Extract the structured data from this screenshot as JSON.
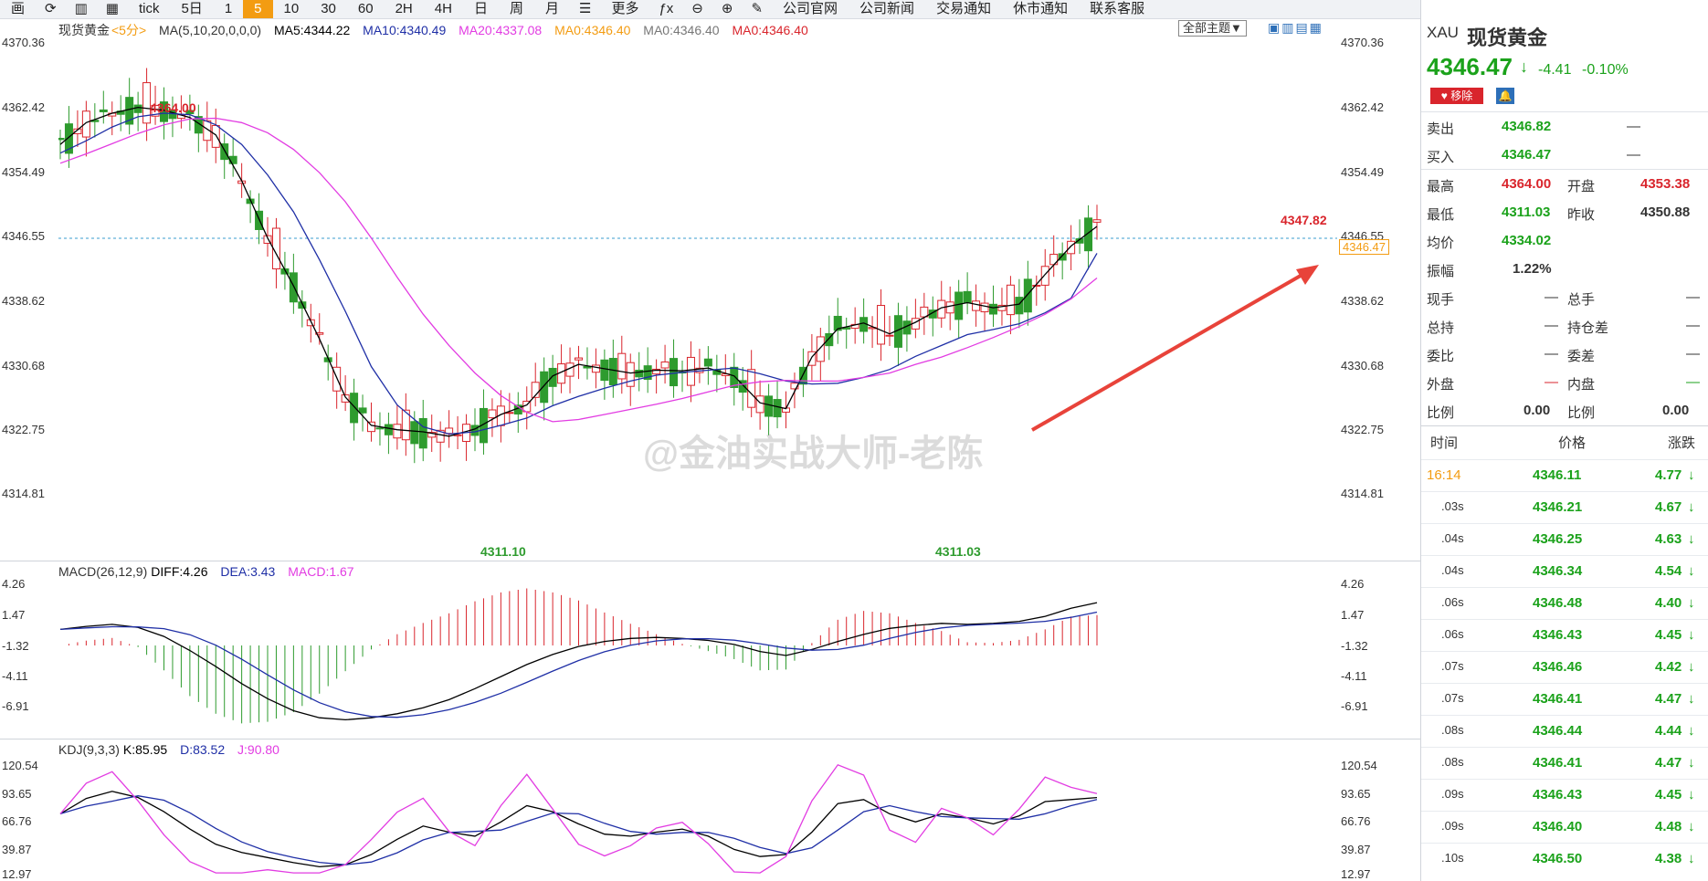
{
  "toolbar": {
    "left_text": "画",
    "periods": [
      "tick",
      "5日",
      "1",
      "5",
      "10",
      "30",
      "60",
      "2H",
      "4H",
      "日",
      "周",
      "月"
    ],
    "active_period": "5",
    "more": "更多",
    "links": [
      "公司官网",
      "公司新闻",
      "交易通知",
      "休市通知",
      "联系客服"
    ]
  },
  "main_legend": {
    "symbol": "现货黄金",
    "period": "<5分>",
    "ma_setting": "MA(5,10,20,0,0,0)",
    "ma5": "MA5:4344.22",
    "ma10": "MA10:4340.49",
    "ma20": "MA20:4337.08",
    "ma0a": "MA0:4346.40",
    "ma0b": "MA0:4346.40",
    "ma0c": "MA0:4346.40",
    "theme_button": "全部主题▼"
  },
  "price_axis": [
    "4370.36",
    "4362.42",
    "4354.49",
    "4346.55",
    "4338.62",
    "4330.68",
    "4322.75",
    "4314.81"
  ],
  "current_price_tag": "4346.47",
  "annotations": {
    "high": "4364.00",
    "low1": "4311.10",
    "low2": "4311.03",
    "recent_high": "4347.82"
  },
  "watermark": "@金油实战大师-老陈",
  "macd_legend": {
    "setting": "MACD(26,12,9)",
    "diff": "DIFF:4.26",
    "dea": "DEA:3.43",
    "macd": "MACD:1.67"
  },
  "macd_axis": [
    "4.26",
    "1.47",
    "-1.32",
    "-4.11",
    "-6.91"
  ],
  "kdj_legend": {
    "setting": "KDJ(9,3,3)",
    "k": "K:85.95",
    "d": "D:83.52",
    "j": "J:90.80"
  },
  "kdj_axis": [
    "120.54",
    "93.65",
    "66.76",
    "39.87",
    "12.97"
  ],
  "colors": {
    "up": "#d9252c",
    "down": "#2e9b2e",
    "ma5": "#000000",
    "ma10": "#1f2fa6",
    "ma20": "#e23ce2",
    "accent": "#f39c12",
    "arrow": "#e8433a"
  },
  "quote": {
    "code": "XAU",
    "name": "现货黄金",
    "price": "4346.47",
    "change": "-4.41",
    "change_pct": "-0.10%",
    "remove_btn": "移除",
    "sell_label": "卖出",
    "sell": "4346.82",
    "sell_vol": "—",
    "buy_label": "买入",
    "buy": "4346.47",
    "buy_vol": "—",
    "high_label": "最高",
    "high": "4364.00",
    "open_label": "开盘",
    "open": "4353.38",
    "low_label": "最低",
    "low": "4311.03",
    "prev_label": "昨收",
    "prev": "4350.88",
    "avg_label": "均价",
    "avg": "4334.02",
    "amp_label": "振幅",
    "amp": "1.22%",
    "hand_label": "现手",
    "hand": "—",
    "total_label": "总手",
    "total": "—",
    "hold_label": "总持",
    "hold": "—",
    "holddiff_label": "持仓差",
    "holddiff": "—",
    "wb_label": "委比",
    "wb": "—",
    "wc_label": "委差",
    "wc": "—",
    "out_label": "外盘",
    "out": "—",
    "in_label": "内盘",
    "in": "—",
    "r1_label": "比例",
    "r1": "0.00",
    "r2_label": "比例",
    "r2": "0.00"
  },
  "ticks_header": {
    "time": "时间",
    "price": "价格",
    "chg": "涨跌"
  },
  "ticks": [
    {
      "t": "16:14",
      "p": "4346.11",
      "c": "4.77"
    },
    {
      "t": ".03s",
      "p": "4346.21",
      "c": "4.67"
    },
    {
      "t": ".04s",
      "p": "4346.25",
      "c": "4.63"
    },
    {
      "t": ".04s",
      "p": "4346.34",
      "c": "4.54"
    },
    {
      "t": ".06s",
      "p": "4346.48",
      "c": "4.40"
    },
    {
      "t": ".06s",
      "p": "4346.43",
      "c": "4.45"
    },
    {
      "t": ".07s",
      "p": "4346.46",
      "c": "4.42"
    },
    {
      "t": ".07s",
      "p": "4346.41",
      "c": "4.47"
    },
    {
      "t": ".08s",
      "p": "4346.44",
      "c": "4.44"
    },
    {
      "t": ".08s",
      "p": "4346.41",
      "c": "4.47"
    },
    {
      "t": ".09s",
      "p": "4346.43",
      "c": "4.45"
    },
    {
      "t": ".09s",
      "p": "4346.40",
      "c": "4.48"
    },
    {
      "t": ".10s",
      "p": "4346.50",
      "c": "4.38"
    }
  ],
  "chart_data": {
    "type": "line",
    "title": "现货黄金 <5分>",
    "ylim": [
      4311.0,
      4370.36
    ],
    "x": [
      0,
      1,
      2,
      3,
      4,
      5,
      6,
      7,
      8,
      9,
      10,
      11,
      12,
      13,
      14,
      15,
      16,
      17,
      18,
      19,
      20,
      21,
      22,
      23,
      24,
      25,
      26,
      27,
      28,
      29,
      30,
      31,
      32,
      33,
      34,
      35,
      36,
      37,
      38,
      39,
      40
    ],
    "series": [
      {
        "name": "MA5",
        "values": [
          4355.5,
          4358.5,
          4359.8,
          4360.6,
          4360.2,
          4359.2,
          4356.8,
          4350.5,
          4342.6,
          4336.0,
          4328.7,
          4320.7,
          4316.8,
          4316.2,
          4315.9,
          4315.3,
          4316.3,
          4318.3,
          4319.6,
          4323.6,
          4325.2,
          4324.6,
          4324.0,
          4324.4,
          4324.3,
          4324.7,
          4323.6,
          4319.9,
          4319.1,
          4326.2,
          4330.1,
          4330.9,
          4329.4,
          4331.0,
          4333.0,
          4333.7,
          4333.0,
          4333.5,
          4337.6,
          4341.5,
          4344.2
        ]
      },
      {
        "name": "MA10",
        "values": [
          4354.3,
          4356.0,
          4357.9,
          4359.3,
          4359.8,
          4359.6,
          4358.2,
          4355.5,
          4351.3,
          4346.2,
          4339.6,
          4332.5,
          4324.9,
          4319.6,
          4316.6,
          4315.6,
          4315.9,
          4316.8,
          4317.8,
          4319.5,
          4320.8,
          4321.9,
          4322.9,
          4323.7,
          4324.1,
          4324.4,
          4324.7,
          4323.9,
          4322.9,
          4322.5,
          4322.6,
          4323.4,
          4324.5,
          4326.3,
          4327.8,
          4329.3,
          4330.0,
          4330.8,
          4332.3,
          4334.3,
          4340.5
        ]
      },
      {
        "name": "MA20",
        "values": [
          4352.9,
          4354.2,
          4355.6,
          4357.0,
          4358.2,
          4359.0,
          4359.1,
          4358.5,
          4357.1,
          4354.8,
          4351.6,
          4347.6,
          4342.6,
          4337.2,
          4332.1,
          4327.8,
          4324.0,
          4320.9,
          4318.6,
          4317.3,
          4317.6,
          4318.3,
          4319.0,
          4319.7,
          4320.5,
          4321.4,
          4322.3,
          4322.8,
          4323.0,
          4322.9,
          4322.9,
          4323.4,
          4324.0,
          4325.2,
          4326.2,
          4327.5,
          4328.9,
          4330.4,
          4332.1,
          4334.2,
          4337.1
        ]
      }
    ],
    "macd": {
      "diff": [
        1.6,
        1.9,
        2.1,
        1.8,
        0.9,
        -0.5,
        -2.1,
        -3.8,
        -5.3,
        -6.5,
        -7.2,
        -7.4,
        -7.2,
        -6.8,
        -6.2,
        -5.4,
        -4.3,
        -3.1,
        -1.9,
        -0.9,
        -0.1,
        0.4,
        0.7,
        0.8,
        0.7,
        0.5,
        0.1,
        -0.6,
        -1.0,
        -0.4,
        0.4,
        1.1,
        1.7,
        2.0,
        2.2,
        2.1,
        2.2,
        2.4,
        2.9,
        3.7,
        4.26
      ]
    },
    "kdj": {
      "k": [
        70,
        85,
        92,
        86,
        72,
        55,
        40,
        32,
        27,
        22,
        18,
        20,
        30,
        45,
        58,
        52,
        48,
        62,
        78,
        72,
        60,
        50,
        48,
        52,
        55,
        48,
        35,
        28,
        30,
        52,
        80,
        84,
        70,
        62,
        70,
        66,
        60,
        68,
        82,
        84,
        85.95
      ]
    }
  }
}
